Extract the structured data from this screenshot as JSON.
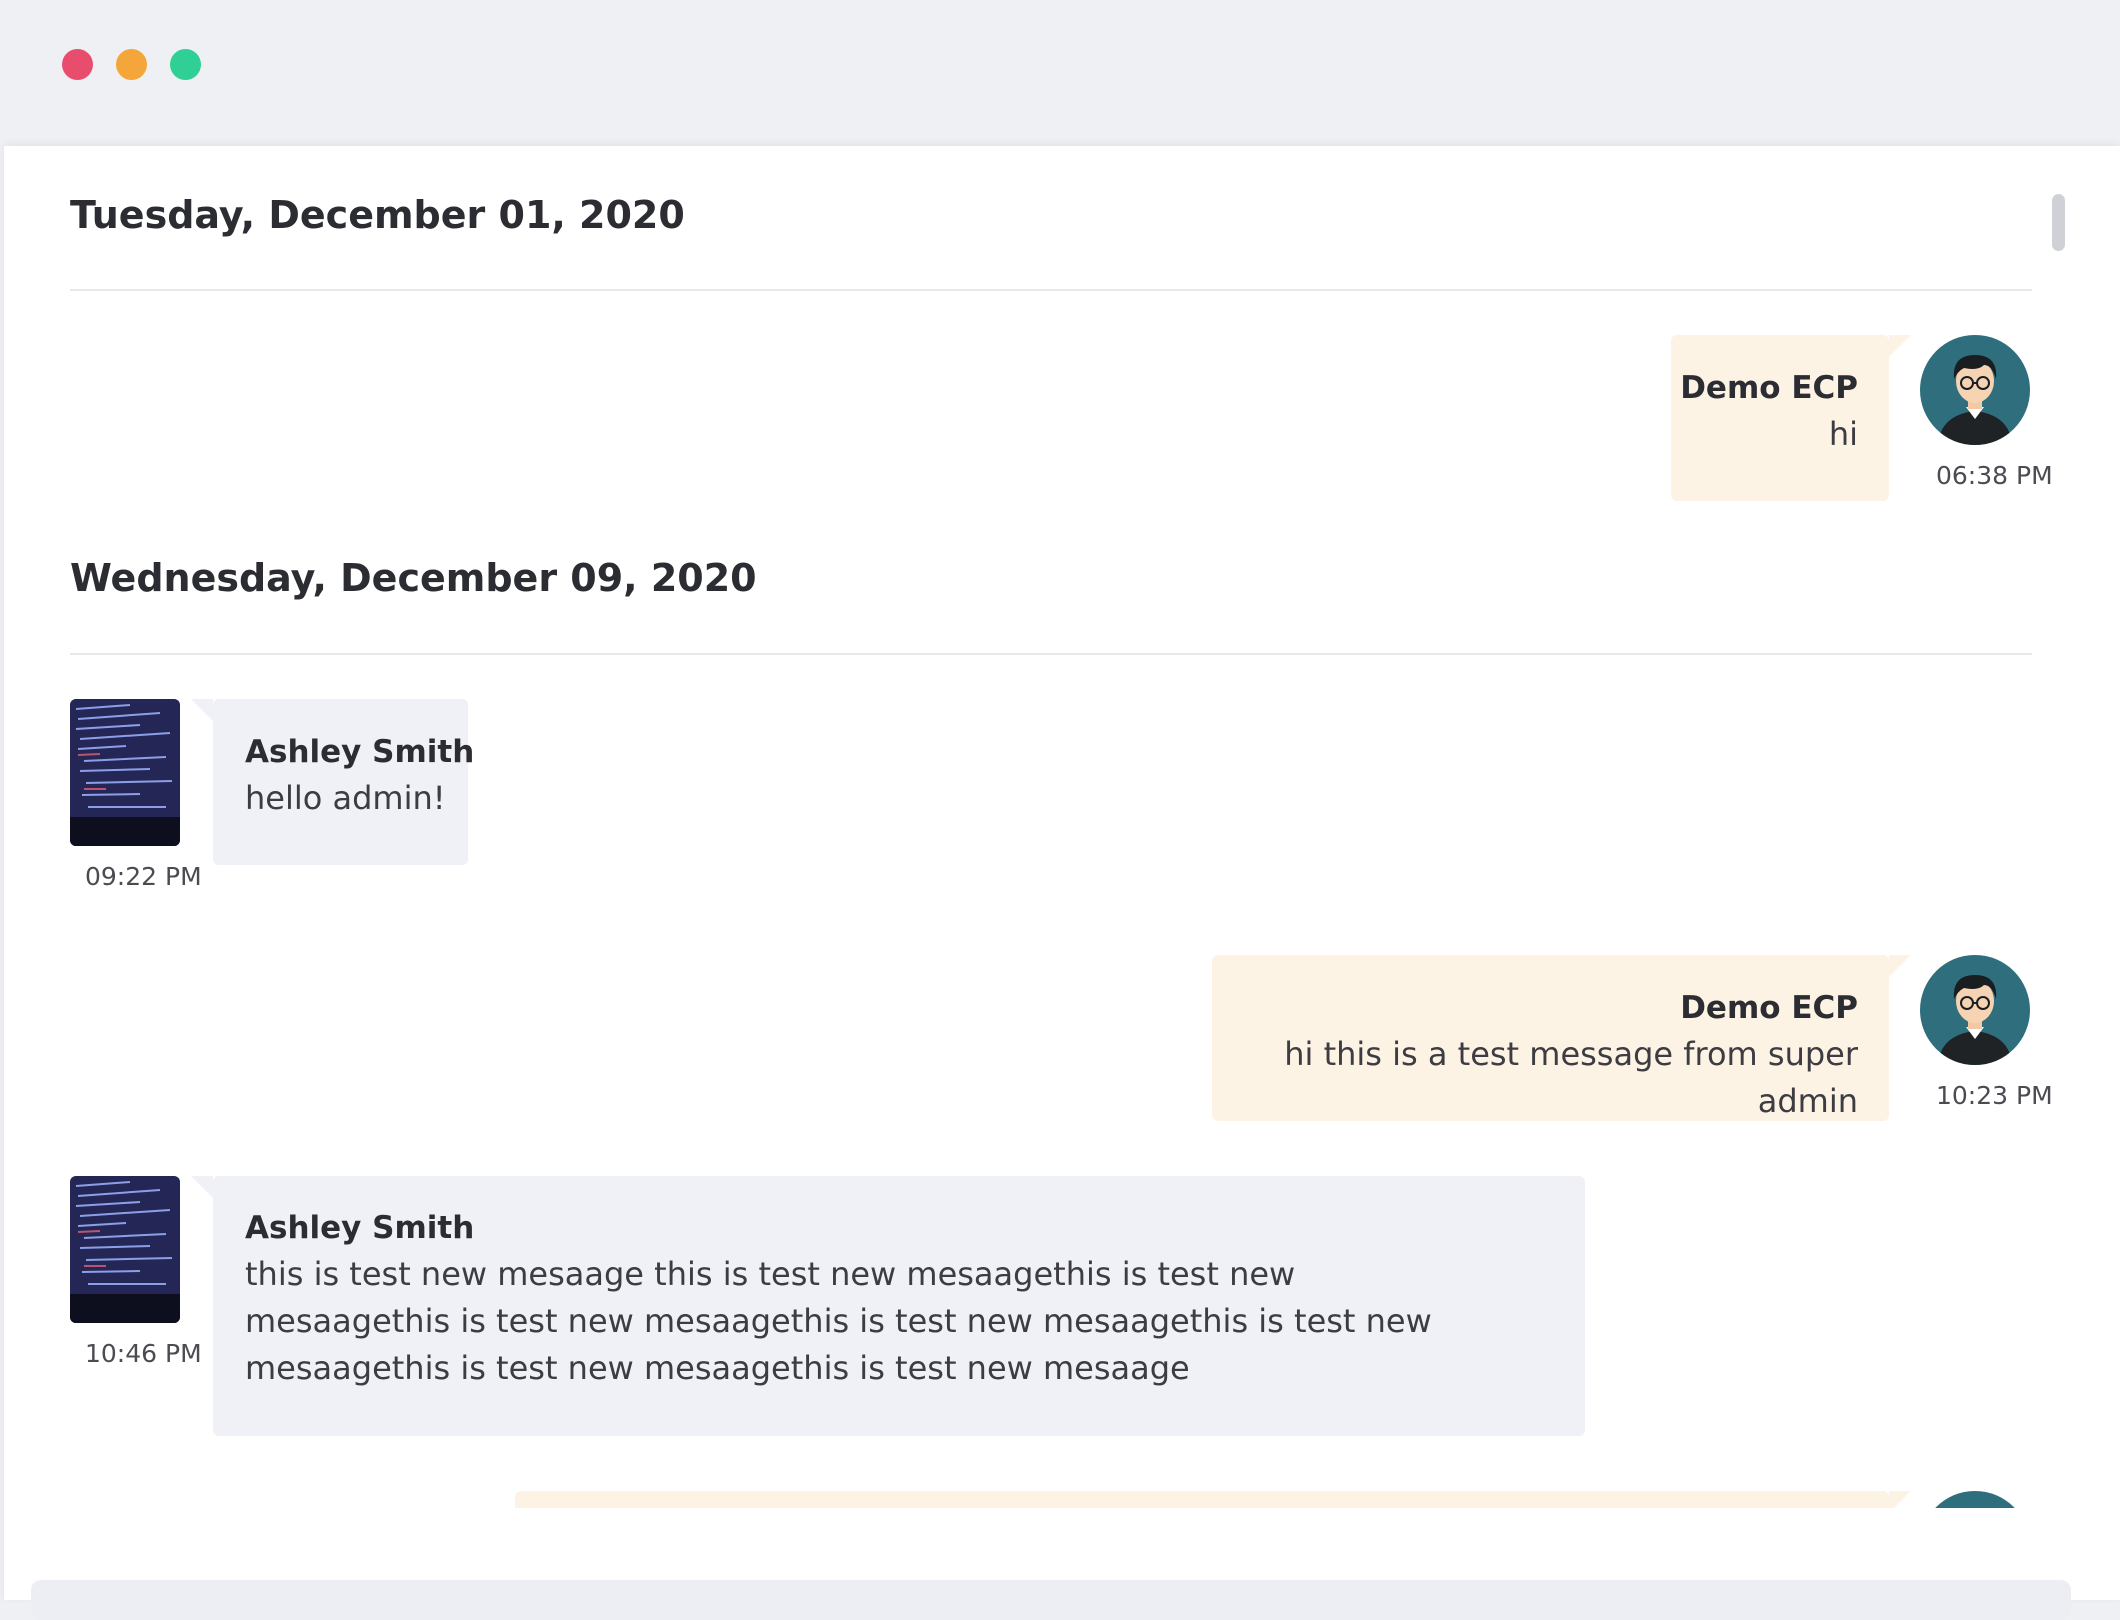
{
  "window": {
    "controls": [
      "close",
      "minimize",
      "maximize"
    ]
  },
  "conversation": {
    "days": [
      {
        "date": "Tuesday, December 01, 2020",
        "messages": [
          {
            "direction": "outgoing",
            "sender": "Demo ECP",
            "text": "hi",
            "time": "06:38 PM",
            "avatar": "man-glasses-avatar"
          }
        ]
      },
      {
        "date": "Wednesday, December 09, 2020",
        "messages": [
          {
            "direction": "incoming",
            "sender": "Ashley Smith",
            "text": "hello admin!",
            "time": "09:22 PM",
            "avatar": "code-screen-photo"
          },
          {
            "direction": "outgoing",
            "sender": "Demo ECP",
            "text": "hi this is a test message from super admin",
            "time": "10:23 PM",
            "avatar": "man-glasses-avatar"
          },
          {
            "direction": "incoming",
            "sender": "Ashley Smith",
            "text": "this is test new mesaage this is test new mesaagethis is test new mesaagethis is test new mesaagethis is test new mesaagethis is test new mesaagethis is test new mesaagethis is test new mesaage",
            "time": "10:46 PM",
            "avatar": "code-screen-photo"
          }
        ]
      }
    ]
  },
  "colors": {
    "outgoing_bubble": "#fdf3e5",
    "incoming_bubble": "#f0f1f6",
    "close_dot": "#e94d6e",
    "minimize_dot": "#f4a63a",
    "maximize_dot": "#2fcf95",
    "avatar_bg": "#2f6f7d"
  }
}
